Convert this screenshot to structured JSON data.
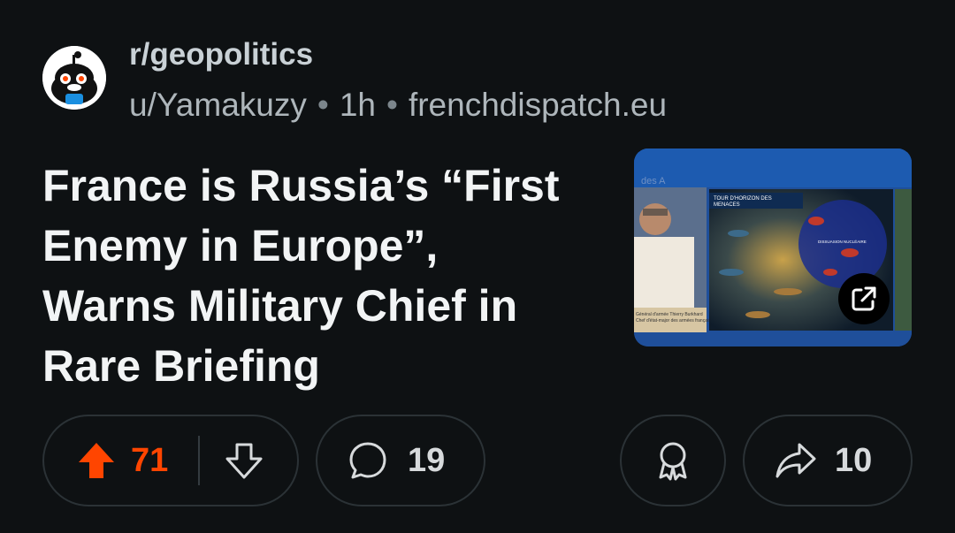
{
  "post": {
    "subreddit": "r/geopolitics",
    "author": "u/Yamakuzy",
    "separator": "•",
    "age": "1h",
    "domain": "frenchdispatch.eu",
    "title": "France is Russia’s “First Enemy in Europe”, Warns Military Chief in Rare Briefing"
  },
  "thumbnail": {
    "banner_text": "des A",
    "slide_title_line1": "TOUR D'HORIZON DES",
    "slide_title_line2": "MENACES",
    "caption_line1": "Général d'armée Thierry Burkhard",
    "caption_line2": "Chef d'état-major des armées françaises",
    "map_label": "DISSUASION NUCLÉAIRE"
  },
  "actions": {
    "upvotes": "71",
    "comments": "19",
    "shares": "10"
  },
  "colors": {
    "background": "#0e1113",
    "upvote_accent": "#ff4500",
    "pill_border": "#2b3236",
    "thumbnail_border": "#1f4f9a"
  },
  "icons": [
    "reddit-snoo-icon",
    "external-link-icon",
    "upvote-arrow-icon",
    "downvote-arrow-icon",
    "comment-bubble-icon",
    "award-ribbon-icon",
    "share-arrow-icon"
  ]
}
